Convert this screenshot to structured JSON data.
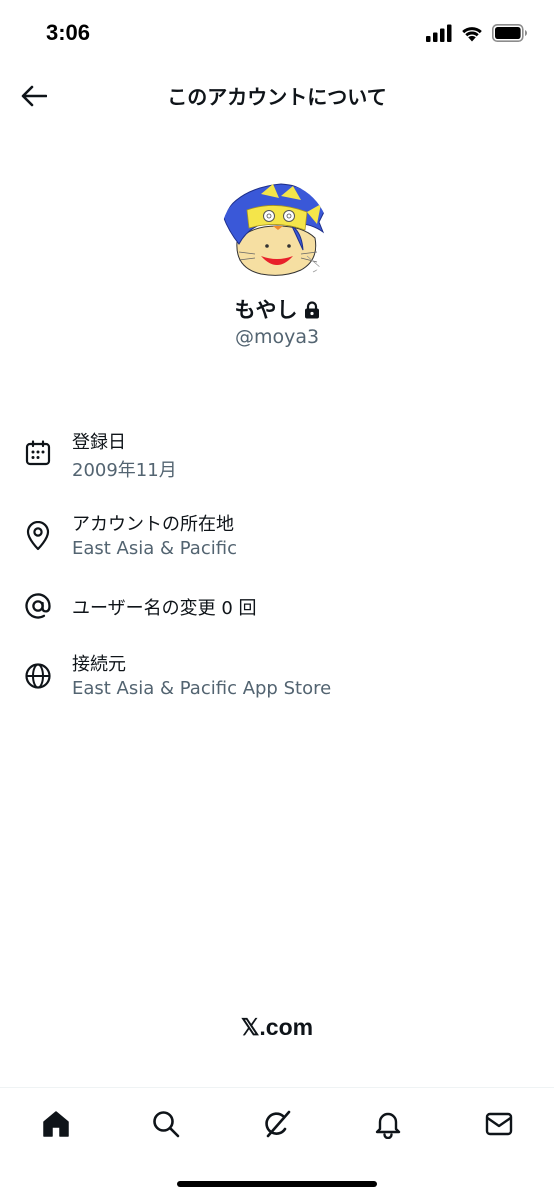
{
  "status_bar": {
    "time": "3:06"
  },
  "header": {
    "title": "このアカウントについて"
  },
  "profile": {
    "name": "もやし",
    "handle": "@moya3"
  },
  "info": {
    "joined": {
      "label": "登録日",
      "value": "2009年11月"
    },
    "location": {
      "label": "アカウントの所在地",
      "value": "East Asia & Pacific"
    },
    "username_changes": {
      "label": "ユーザー名の変更 0 回"
    },
    "connected_via": {
      "label": "接続元",
      "value": "East Asia & Pacific App Store"
    }
  },
  "footer": {
    "brand": "𝕏.com"
  },
  "colors": {
    "text": "#0f1419",
    "secondary": "#536471",
    "divider": "#eff3f4"
  },
  "tab_bar": {
    "items": [
      "home-icon",
      "search-icon",
      "grok-icon",
      "notifications-icon",
      "messages-icon"
    ]
  }
}
